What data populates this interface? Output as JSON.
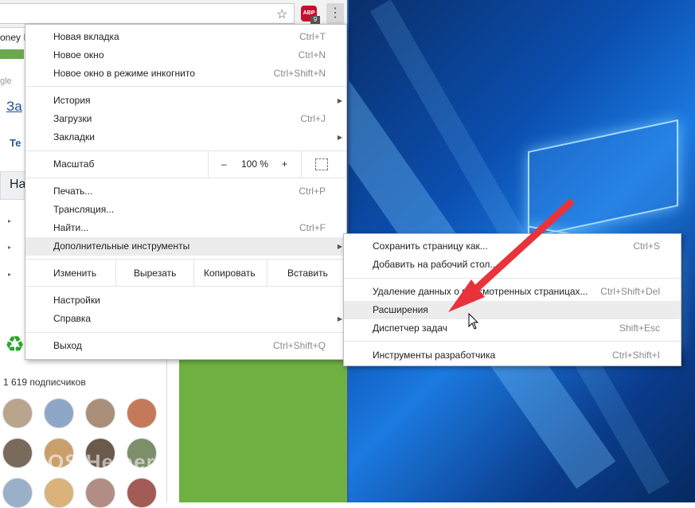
{
  "browser": {
    "partial_texts": {
      "money": "oney I",
      "google": "gle",
      "za": "За",
      "te": "Те",
      "na": "На",
      "subscribers": "1 619 подписчиков"
    },
    "abp_badge": "ABP",
    "abp_count": "9"
  },
  "main_menu": {
    "new_tab": {
      "label": "Новая вкладка",
      "shortcut": "Ctrl+T"
    },
    "new_window": {
      "label": "Новое окно",
      "shortcut": "Ctrl+N"
    },
    "incognito": {
      "label": "Новое окно в режиме инкогнито",
      "shortcut": "Ctrl+Shift+N"
    },
    "history": {
      "label": "История"
    },
    "downloads": {
      "label": "Загрузки",
      "shortcut": "Ctrl+J"
    },
    "bookmarks": {
      "label": "Закладки"
    },
    "zoom": {
      "label": "Масштаб",
      "minus": "–",
      "value": "100 %",
      "plus": "+"
    },
    "print": {
      "label": "Печать...",
      "shortcut": "Ctrl+P"
    },
    "cast": {
      "label": "Трансляция..."
    },
    "find": {
      "label": "Найти...",
      "shortcut": "Ctrl+F"
    },
    "more_tools": {
      "label": "Дополнительные инструменты"
    },
    "edit": {
      "label": "Изменить",
      "cut": "Вырезать",
      "copy": "Копировать",
      "paste": "Вставить"
    },
    "settings": {
      "label": "Настройки"
    },
    "help": {
      "label": "Справка"
    },
    "exit": {
      "label": "Выход",
      "shortcut": "Ctrl+Shift+Q"
    }
  },
  "submenu": {
    "save_page": {
      "label": "Сохранить страницу как...",
      "shortcut": "Ctrl+S"
    },
    "add_desktop": {
      "label": "Добавить на рабочий стол..."
    },
    "clear_data": {
      "label": "Удаление данных о просмотренных страницах...",
      "shortcut": "Ctrl+Shift+Del"
    },
    "extensions": {
      "label": "Расширения"
    },
    "task_manager": {
      "label": "Диспетчер задач",
      "shortcut": "Shift+Esc"
    },
    "dev_tools": {
      "label": "Инструменты разработчика",
      "shortcut": "Ctrl+Shift+I"
    }
  },
  "watermark": "OS Helper",
  "colors": {
    "arrow": "#e8333a",
    "desktop": "#0b4fb0",
    "green": "#6fb043"
  }
}
